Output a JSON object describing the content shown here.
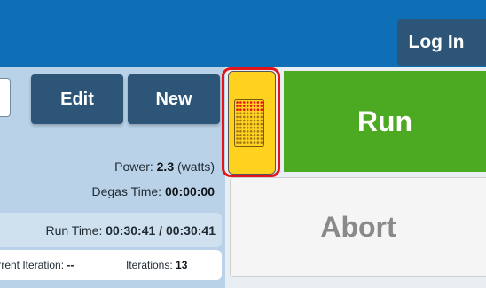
{
  "header": {
    "login_label": "Log In"
  },
  "toolbar": {
    "edit_label": "Edit",
    "new_label": "New"
  },
  "status": {
    "power_label": "Power:",
    "power_value": "2.3",
    "power_unit": "(watts)",
    "degas_label": "Degas Time:",
    "degas_value": "00:00:00",
    "runtime_label": "Run Time:",
    "runtime_value": "00:30:41 / 00:30:41",
    "current_iteration_label": "Current Iteration:",
    "current_iteration_value": "--",
    "iterations_label": "Iterations:",
    "iterations_value": "13"
  },
  "controls": {
    "run_label": "Run",
    "abort_label": "Abort"
  },
  "colors": {
    "header_bg": "#0e6fb6",
    "button_dark": "#2c5578",
    "run_green": "#4caa22",
    "plate_yellow": "#ffd21f",
    "highlight_red": "#e3141c",
    "panel_blue": "#b9d2e8"
  },
  "icons": {
    "plate": "well-plate-icon"
  }
}
